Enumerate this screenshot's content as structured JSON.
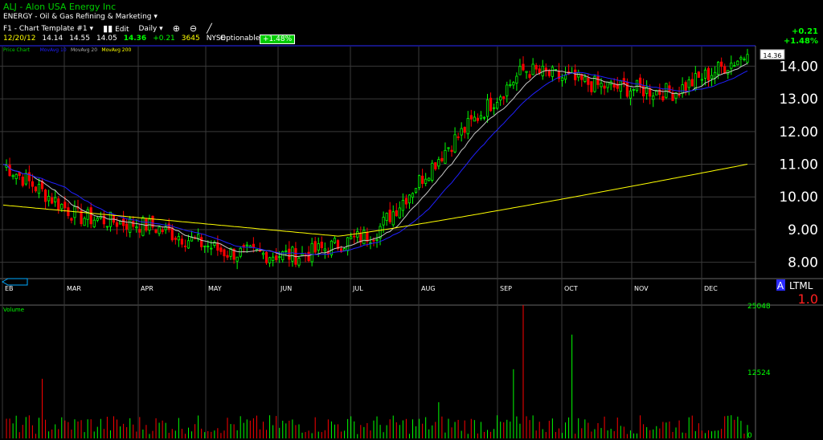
{
  "header": {
    "symbol_line": "ALJ - Alon USA Energy Inc",
    "sector_line": "ENERGY - Oil & Gas Refining & Marketing",
    "chart_template": "F1 - Chart Template #1",
    "edit_label": "Edit",
    "period_label": "Daily",
    "quote": {
      "date": "12/20/12",
      "open": "14.14",
      "high": "14.55",
      "low": "14.05",
      "last": "14.36",
      "change": "+0.21",
      "volume": "3645",
      "exchange": "NYSE"
    },
    "optionable_label": "Optionable",
    "pct_badge": "+1.48%",
    "right_change": "+0.21",
    "right_pct": "+1.48%"
  },
  "colors": {
    "background": "#000000",
    "up": "#00ff00",
    "down": "#ff0000",
    "ma10": "#c8c8c8",
    "ma20": "#2020ff",
    "ma200": "#ffff00",
    "grid": "#3a3a3a",
    "axis_text": "#ffffff",
    "volume_label": "#00ff00"
  },
  "chart_data": [
    {
      "type": "candlestick",
      "legend": [
        "Price Chart",
        "MovAvg 10",
        "MovAvg 20",
        "MovAvg 200"
      ],
      "last_price_label": "14.36",
      "ylim": [
        7.5,
        14.6
      ],
      "yticks": [
        "14.00",
        "13.00",
        "12.00",
        "11.00",
        "10.00",
        "9.00",
        "8.00"
      ],
      "xticks": [
        "EB",
        "MAR",
        "APR",
        "MAY",
        "JUN",
        "JUL",
        "AUG",
        "SEP",
        "OCT",
        "NOV",
        "DEC"
      ],
      "corner_text": "A L T M L",
      "corner_value": "1.0",
      "close_approx": [
        {
          "month": "FEB",
          "close": 11.0
        },
        {
          "month": "MAR",
          "close": 9.4
        },
        {
          "month": "APR",
          "close": 9.1
        },
        {
          "month": "MAY",
          "close": 8.3
        },
        {
          "month": "JUN",
          "close": 8.2
        },
        {
          "month": "JUL",
          "close": 8.9
        },
        {
          "month": "AUG",
          "close": 11.6
        },
        {
          "month": "SEP",
          "close": 13.9
        },
        {
          "month": "OCT",
          "close": 13.4
        },
        {
          "month": "NOV",
          "close": 13.2
        },
        {
          "month": "DEC",
          "close": 14.36
        }
      ],
      "ma200_range": [
        8.8,
        11.0
      ]
    },
    {
      "type": "bar",
      "title": "Volume",
      "yticks": [
        "25048",
        "12524",
        "0"
      ],
      "ylim": [
        0,
        25048
      ]
    }
  ]
}
